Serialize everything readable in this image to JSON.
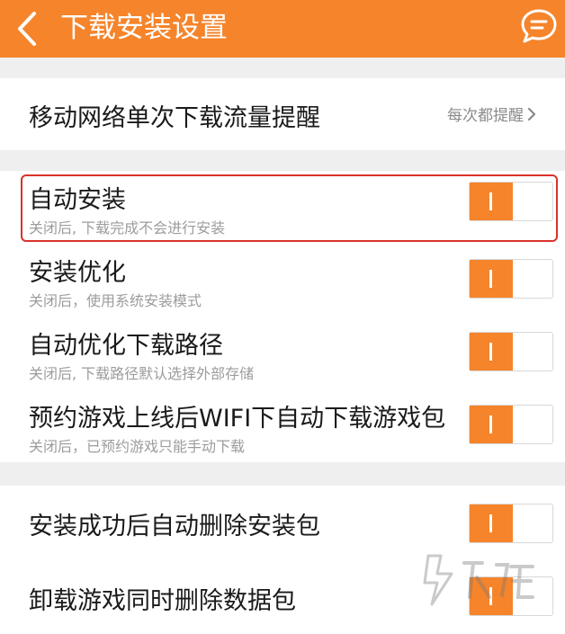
{
  "header": {
    "title": "下载安装设置",
    "back_icon": "chevron-left-icon",
    "message_icon": "chat-bubble-icon",
    "background": "#f5842b"
  },
  "mobile_data_reminder": {
    "label": "移动网络单次下载流量提醒",
    "value": "每次都提醒"
  },
  "settings": [
    {
      "title": "自动安装",
      "subtitle": "关闭后, 下载完成不会进行安装",
      "enabled": true,
      "highlighted": true
    },
    {
      "title": "安装优化",
      "subtitle": "关闭后，使用系统安装模式",
      "enabled": true
    },
    {
      "title": "自动优化下载路径",
      "subtitle": "关闭后, 下载路径默认选择外部存储",
      "enabled": true
    },
    {
      "title": "预约游戏上线后WIFI下自动下载游戏包",
      "subtitle": "关闭后，已预约游戏只能手动下载",
      "enabled": true
    }
  ],
  "cleanup": [
    {
      "title": "安装成功后自动删除安装包",
      "enabled": true
    },
    {
      "title": "卸载游戏同时删除数据包",
      "enabled": true
    }
  ],
  "colors": {
    "accent": "#f5842b",
    "highlight_border": "#d9322b"
  }
}
